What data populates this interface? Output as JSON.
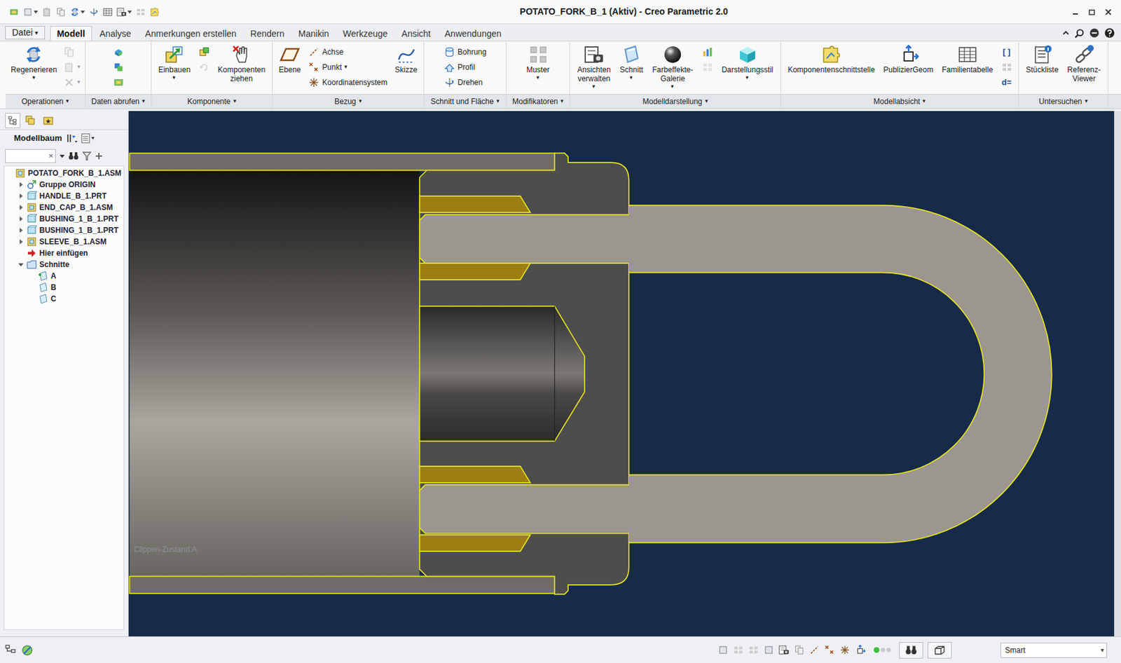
{
  "window": {
    "title": "POTATO_FORK_B_1 (Aktiv) - Creo Parametric 2.0"
  },
  "tabs": [
    {
      "label": "Datei",
      "arrow": "▾",
      "selected": false
    },
    {
      "label": "Modell",
      "selected": true
    },
    {
      "label": "Analyse",
      "selected": false
    },
    {
      "label": "Anmerkungen erstellen",
      "selected": false
    },
    {
      "label": "Rendern",
      "selected": false
    },
    {
      "label": "Manikin",
      "selected": false
    },
    {
      "label": "Werkzeuge",
      "selected": false
    },
    {
      "label": "Ansicht",
      "selected": false
    },
    {
      "label": "Anwendungen",
      "selected": false
    }
  ],
  "ribbon": {
    "groups": [
      {
        "label": "Operationen",
        "arrow": "▾",
        "columns": [
          {
            "kind": "large",
            "buttons": [
              {
                "kind": "large",
                "label": "Regenerieren",
                "arrow": "▾",
                "disabled": false
              }
            ]
          },
          {
            "kind": "stack",
            "buttons": [
              {
                "kind": "icon",
                "disabled": true
              },
              {
                "kind": "icon",
                "arrow": "▾",
                "disabled": true
              },
              {
                "kind": "icon",
                "arrow": "▾",
                "disabled": true
              }
            ]
          }
        ]
      },
      {
        "label": "Daten abrufen",
        "arrow": "▾",
        "columns": [
          {
            "kind": "stack",
            "buttons": [
              {
                "kind": "icon",
                "disabled": false
              },
              {
                "kind": "icon",
                "disabled": false
              },
              {
                "kind": "icon",
                "disabled": false
              }
            ]
          }
        ]
      },
      {
        "label": "Komponente",
        "arrow": "▾",
        "columns": [
          {
            "kind": "large",
            "buttons": [
              {
                "kind": "large",
                "label": "Einbauen",
                "arrow": "▾",
                "disabled": false
              }
            ]
          },
          {
            "kind": "stack",
            "buttons": [
              {
                "kind": "icon",
                "disabled": false
              },
              {
                "kind": "icon",
                "disabled": true
              }
            ]
          },
          {
            "kind": "large",
            "buttons": [
              {
                "kind": "large",
                "label": "Komponenten ziehen",
                "disabled": false
              }
            ]
          }
        ]
      },
      {
        "label": "Bezug",
        "arrow": "▾",
        "columns": [
          {
            "kind": "large",
            "buttons": [
              {
                "kind": "large",
                "label": "Ebene",
                "disabled": false
              }
            ]
          },
          {
            "kind": "stack",
            "buttons": [
              {
                "kind": "small",
                "label": "Achse",
                "disabled": false
              },
              {
                "kind": "small",
                "label": "Punkt",
                "arrow": "▾",
                "disabled": false
              },
              {
                "kind": "small",
                "label": "Koordinatensystem",
                "disabled": false
              }
            ]
          },
          {
            "kind": "large",
            "buttons": [
              {
                "kind": "large",
                "label": "Skizze",
                "disabled": false
              }
            ]
          }
        ]
      },
      {
        "label": "Schnitt und Fläche",
        "arrow": "▾",
        "columns": [
          {
            "kind": "stack",
            "buttons": [
              {
                "kind": "small",
                "label": "Bohrung",
                "disabled": false
              },
              {
                "kind": "small",
                "label": "Profil",
                "disabled": false
              },
              {
                "kind": "small",
                "label": "Drehen",
                "disabled": false
              }
            ]
          }
        ]
      },
      {
        "label": "Modifikatoren",
        "arrow": "▾",
        "columns": [
          {
            "kind": "large",
            "buttons": [
              {
                "kind": "large",
                "label": "Muster",
                "arrow": "▾",
                "disabled": false
              }
            ]
          }
        ]
      },
      {
        "label": "Modelldarstellung",
        "arrow": "▾",
        "columns": [
          {
            "kind": "large",
            "buttons": [
              {
                "kind": "large",
                "label": "Ansichten verwalten",
                "arrow": "▾",
                "disabled": false
              }
            ]
          },
          {
            "kind": "large",
            "buttons": [
              {
                "kind": "large",
                "label": "Schnitt",
                "arrow": "▾",
                "disabled": false
              }
            ]
          },
          {
            "kind": "large",
            "buttons": [
              {
                "kind": "large",
                "label": "Farbeffekte-Galerie",
                "arrow": "▾",
                "disabled": false
              }
            ]
          },
          {
            "kind": "stack",
            "buttons": [
              {
                "kind": "icon",
                "disabled": false
              },
              {
                "kind": "icon",
                "disabled": true
              }
            ]
          },
          {
            "kind": "large",
            "buttons": [
              {
                "kind": "large",
                "label": "Darstellungsstil",
                "arrow": "▾",
                "disabled": false
              }
            ]
          }
        ]
      },
      {
        "label": "Modellabsicht",
        "arrow": "▾",
        "columns": [
          {
            "kind": "large",
            "buttons": [
              {
                "kind": "large",
                "label": "Komponentenschnittstelle",
                "disabled": false
              }
            ]
          },
          {
            "kind": "large",
            "buttons": [
              {
                "kind": "large",
                "label": "PublizierGeom",
                "disabled": false
              }
            ]
          },
          {
            "kind": "large",
            "buttons": [
              {
                "kind": "large",
                "label": "Familientabelle",
                "disabled": false
              }
            ]
          },
          {
            "kind": "stack",
            "buttons": [
              {
                "kind": "glyph",
                "label": "[ ]",
                "disabled": false
              },
              {
                "kind": "icon",
                "disabled": false
              },
              {
                "kind": "glyph",
                "label": "d=",
                "disabled": false
              }
            ]
          }
        ]
      },
      {
        "label": "Untersuchen",
        "arrow": "▾",
        "columns": [
          {
            "kind": "large",
            "buttons": [
              {
                "kind": "large",
                "label": "Stückliste",
                "disabled": false
              }
            ]
          },
          {
            "kind": "large",
            "buttons": [
              {
                "kind": "large",
                "label": "Referenz-Viewer",
                "disabled": false
              }
            ]
          }
        ]
      }
    ]
  },
  "model_tree": {
    "header": "Modellbaum",
    "search": {
      "value": "",
      "clear": "×"
    },
    "items": [
      {
        "label": "POTATO_FORK_B_1.ASM",
        "kind": "assembly",
        "level": 0
      },
      {
        "label": "Gruppe ORIGIN",
        "kind": "group",
        "level": 1,
        "expanded": false
      },
      {
        "label": "HANDLE_B_1.PRT",
        "kind": "part",
        "level": 1,
        "expanded": false
      },
      {
        "label": "END_CAP_B_1.ASM",
        "kind": "assembly",
        "level": 1,
        "expanded": false
      },
      {
        "label": "BUSHING_1_B_1.PRT",
        "kind": "part",
        "level": 1,
        "expanded": false
      },
      {
        "label": "BUSHING_1_B_1.PRT",
        "kind": "part",
        "level": 1,
        "expanded": false
      },
      {
        "label": "SLEEVE_B_1.ASM",
        "kind": "assembly",
        "level": 1,
        "expanded": false
      },
      {
        "label": "Hier einfügen",
        "kind": "insert",
        "level": 1
      },
      {
        "label": "Schnitte",
        "kind": "folder",
        "level": 1,
        "expanded": true
      },
      {
        "label": "A",
        "kind": "section",
        "level": 2,
        "active": true
      },
      {
        "label": "B",
        "kind": "section",
        "level": 2,
        "active": false
      },
      {
        "label": "C",
        "kind": "section",
        "level": 2,
        "active": false
      }
    ]
  },
  "viewport": {
    "clip_state": "Clippen-Zustand:A"
  },
  "status_bar": {
    "filter": {
      "value": "Smart",
      "arrow": "▾"
    }
  }
}
